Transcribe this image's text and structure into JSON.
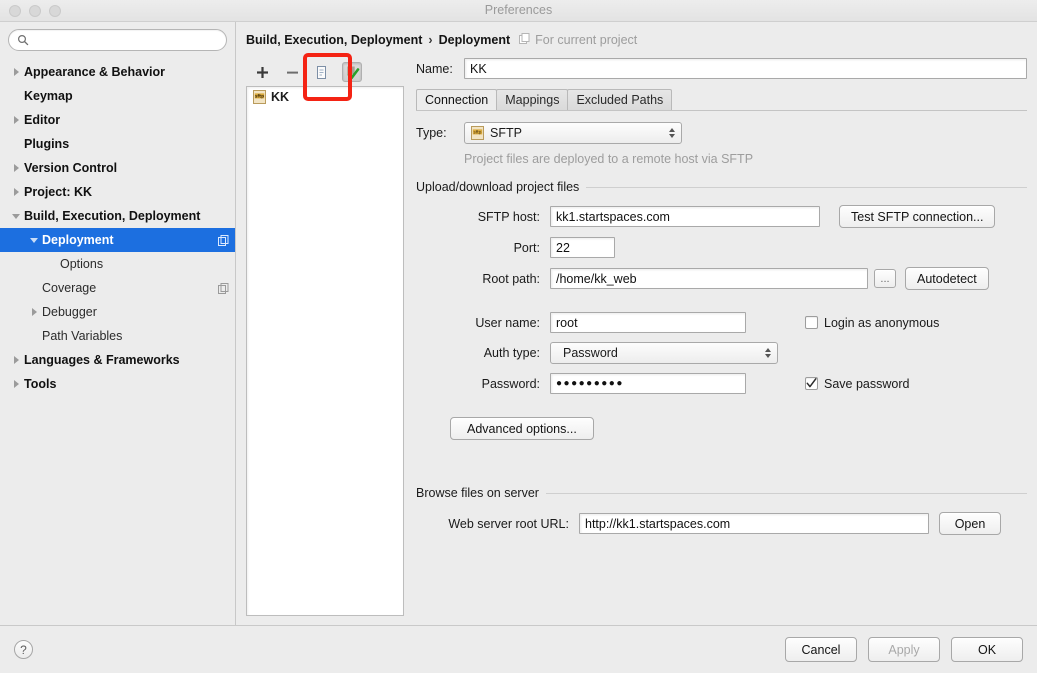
{
  "window": {
    "title": "Preferences",
    "traffic_lights": [
      "close-button",
      "minimize-button",
      "zoom-button"
    ]
  },
  "sidebar": {
    "search": {
      "value": "",
      "placeholder": ""
    },
    "items": [
      {
        "label": "Appearance & Behavior",
        "twisty": "right",
        "indent": 0,
        "bold": true,
        "selected": false,
        "badge": ""
      },
      {
        "label": "Keymap",
        "twisty": "none",
        "indent": 0,
        "bold": true,
        "selected": false,
        "badge": ""
      },
      {
        "label": "Editor",
        "twisty": "right",
        "indent": 0,
        "bold": true,
        "selected": false,
        "badge": ""
      },
      {
        "label": "Plugins",
        "twisty": "none",
        "indent": 0,
        "bold": true,
        "selected": false,
        "badge": ""
      },
      {
        "label": "Version Control",
        "twisty": "right",
        "indent": 0,
        "bold": true,
        "selected": false,
        "badge": ""
      },
      {
        "label": "Project: KK",
        "twisty": "right",
        "indent": 0,
        "bold": true,
        "selected": false,
        "badge": ""
      },
      {
        "label": "Build, Execution, Deployment",
        "twisty": "down",
        "indent": 0,
        "bold": true,
        "selected": false,
        "badge": ""
      },
      {
        "label": "Deployment",
        "twisty": "down",
        "indent": 1,
        "bold": true,
        "selected": true,
        "badge": "copy-icon"
      },
      {
        "label": "Options",
        "twisty": "none",
        "indent": 2,
        "bold": false,
        "selected": false,
        "badge": ""
      },
      {
        "label": "Coverage",
        "twisty": "none",
        "indent": 1,
        "bold": false,
        "selected": false,
        "badge": "copy-icon"
      },
      {
        "label": "Debugger",
        "twisty": "right",
        "indent": 1,
        "bold": false,
        "selected": false,
        "badge": ""
      },
      {
        "label": "Path Variables",
        "twisty": "none",
        "indent": 1,
        "bold": false,
        "selected": false,
        "badge": ""
      },
      {
        "label": "Languages & Frameworks",
        "twisty": "right",
        "indent": 0,
        "bold": true,
        "selected": false,
        "badge": ""
      },
      {
        "label": "Tools",
        "twisty": "right",
        "indent": 0,
        "bold": true,
        "selected": false,
        "badge": ""
      }
    ]
  },
  "breadcrumb": {
    "parent": "Build, Execution, Deployment",
    "separator": "›",
    "current": "Deployment",
    "scope": "For current project"
  },
  "list_panel": {
    "toolbar": {
      "add": "+",
      "remove": "−",
      "copy": "copy-server-icon",
      "default": "set-as-default-icon"
    },
    "items": [
      {
        "icon": "sftp-icon",
        "label": "KK"
      }
    ]
  },
  "form": {
    "name_label": "Name:",
    "name_value": "KK",
    "tabs": [
      {
        "label": "Connection",
        "active": true
      },
      {
        "label": "Mappings",
        "active": false
      },
      {
        "label": "Excluded Paths",
        "active": false
      }
    ],
    "type_label": "Type:",
    "type_value": "SFTP",
    "type_hint": "Project files are deployed to a remote host via SFTP",
    "upload_group": "Upload/download project files",
    "sftp_host_label": "SFTP host:",
    "sftp_host_value": "kk1.startspaces.com",
    "test_connection_button": "Test SFTP connection...",
    "port_label": "Port:",
    "port_value": "22",
    "root_path_label": "Root path:",
    "root_path_value": "/home/kk_web",
    "browse_button": "...",
    "autodetect_button": "Autodetect",
    "user_name_label": "User name:",
    "user_name_value": "root",
    "login_anonymous_label": "Login as anonymous",
    "login_anonymous_checked": false,
    "auth_type_label": "Auth type:",
    "auth_type_value": "Password",
    "password_label": "Password:",
    "password_value": "●●●●●●●●●",
    "save_password_label": "Save password",
    "save_password_checked": true,
    "advanced_options_button": "Advanced options...",
    "browse_group": "Browse files on server",
    "web_url_label": "Web server root URL:",
    "web_url_value": "http://kk1.startspaces.com",
    "open_button": "Open"
  },
  "footer": {
    "help": "?",
    "cancel": "Cancel",
    "apply": "Apply",
    "ok": "OK"
  },
  "colors": {
    "selection_blue": "#1c6fe0",
    "highlight_red": "#f42314",
    "window_bg": "#ececec",
    "field_bg": "#ffffff"
  }
}
